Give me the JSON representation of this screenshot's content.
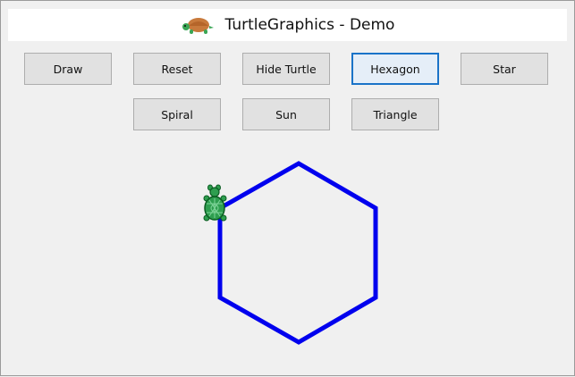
{
  "window": {
    "title": "TurtleGraphics - Demo",
    "icon": "turtle-icon"
  },
  "toolbar": {
    "buttons": [
      {
        "label": "Draw",
        "focused": false
      },
      {
        "label": "Reset",
        "focused": false
      },
      {
        "label": "Hide Turtle",
        "focused": false
      },
      {
        "label": "Hexagon",
        "focused": true
      },
      {
        "label": "Star",
        "focused": false
      },
      {
        "label": "Spiral",
        "focused": false
      },
      {
        "label": "Sun",
        "focused": false
      },
      {
        "label": "Triangle",
        "focused": false
      }
    ]
  },
  "drawing": {
    "shape": "hexagon",
    "stroke_color": "#0000ee",
    "turtle": "turtle-icon",
    "turtle_color": "#2e9e4f"
  },
  "colors": {
    "background": "#f0f0f0",
    "focus_border": "#1a73c8",
    "button_bg": "#e1e1e1"
  }
}
